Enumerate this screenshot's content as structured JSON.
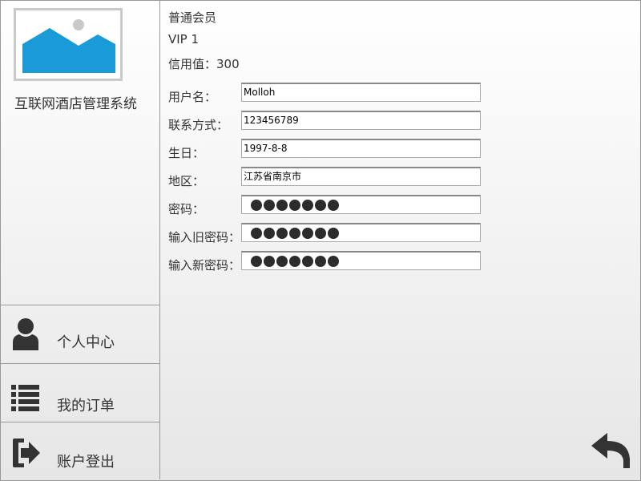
{
  "app": {
    "system_name": "互联网酒店管理系统"
  },
  "sidebar": {
    "items": [
      {
        "label": "个人中心",
        "icon": "user-icon"
      },
      {
        "label": "我的订单",
        "icon": "list-icon"
      },
      {
        "label": "账户登出",
        "icon": "logout-icon"
      }
    ]
  },
  "profile": {
    "member_level": "普通会员",
    "vip_level": "VIP 1",
    "credit_label": "信用值：",
    "credit_value": "300"
  },
  "form": {
    "fields": [
      {
        "label": "用户名：",
        "value": "Molloh"
      },
      {
        "label": "联系方式：",
        "value": "123456789"
      },
      {
        "label": "生日：",
        "value": "1997-8-8"
      },
      {
        "label": "地区：",
        "value": "江苏省南京市"
      },
      {
        "label": "密码：",
        "masked_length": 7
      },
      {
        "label": "输入旧密码：",
        "masked_length": 7
      },
      {
        "label": "输入新密码：",
        "masked_length": 7
      }
    ]
  },
  "actions": {
    "back_icon": "back-arrow-icon"
  },
  "colors": {
    "logo_blue": "#1a9bd7",
    "logo_frame": "#c9c9c9",
    "icon_dark": "#333333",
    "border": "#999999"
  }
}
